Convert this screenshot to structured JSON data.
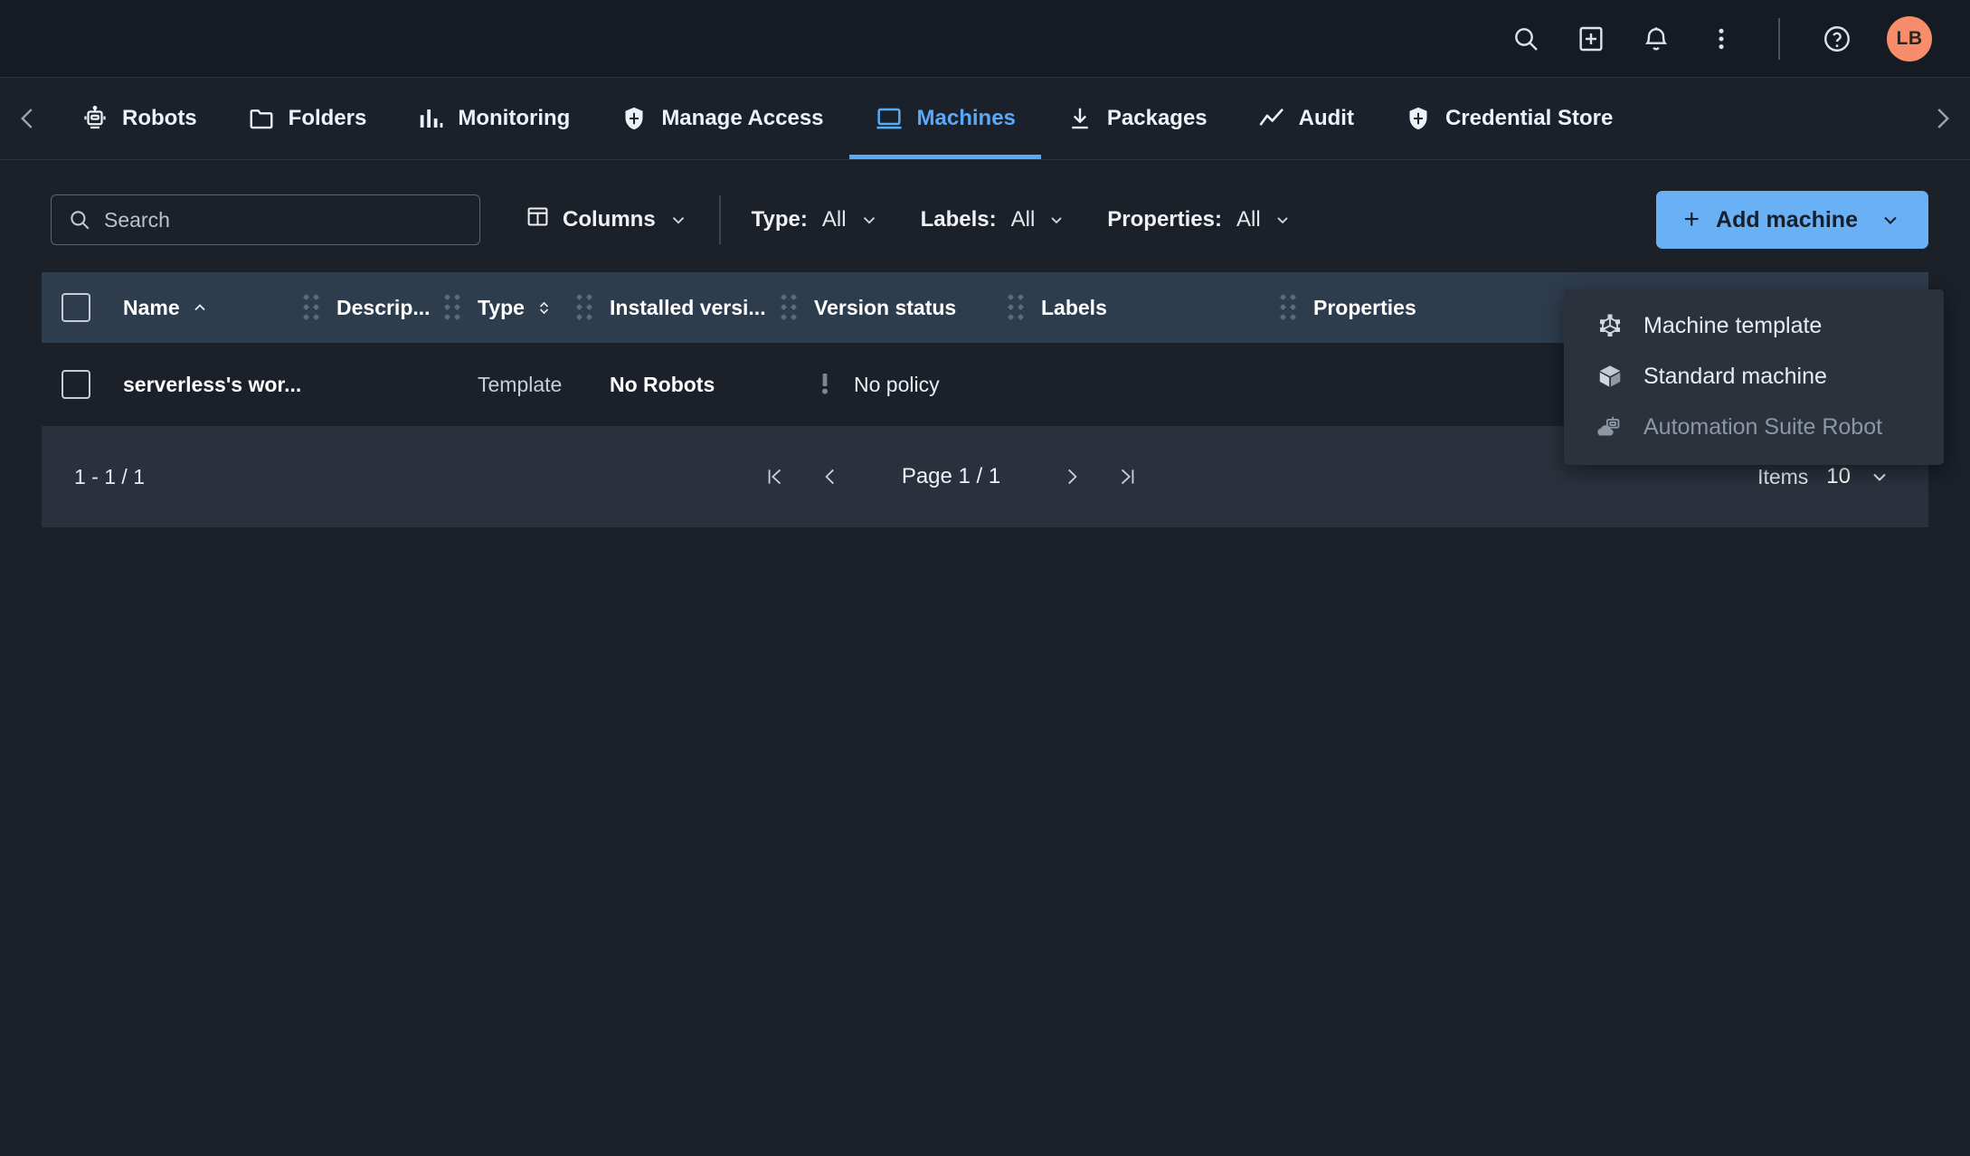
{
  "topbar": {
    "icons": [
      {
        "name": "search-icon",
        "label": "Search"
      },
      {
        "name": "add-square-icon",
        "label": "Create"
      },
      {
        "name": "bell-icon",
        "label": "Notifications"
      },
      {
        "name": "more-vertical-icon",
        "label": "More options"
      },
      {
        "name": "help-circle-icon",
        "label": "Help"
      }
    ],
    "avatar_initials": "LB"
  },
  "nav": {
    "prev_arrow": "chevron-left-icon",
    "next_arrow": "chevron-right-icon",
    "tabs": [
      {
        "label": "Robots",
        "icon": "robot-icon",
        "active": false
      },
      {
        "label": "Folders",
        "icon": "folder-icon",
        "active": false
      },
      {
        "label": "Monitoring",
        "icon": "bar-chart-icon",
        "active": false
      },
      {
        "label": "Manage Access",
        "icon": "shield-icon",
        "active": false
      },
      {
        "label": "Machines",
        "icon": "monitor-icon",
        "active": true
      },
      {
        "label": "Packages",
        "icon": "download-icon",
        "active": false
      },
      {
        "label": "Audit",
        "icon": "trend-line-icon",
        "active": false
      },
      {
        "label": "Credential Store",
        "icon": "shield-icon",
        "active": false
      }
    ]
  },
  "toolbar": {
    "search_placeholder": "Search",
    "search_value": "",
    "columns_label": "Columns",
    "filters": [
      {
        "label": "Type:",
        "value": "All"
      },
      {
        "label": "Labels:",
        "value": "All"
      },
      {
        "label": "Properties:",
        "value": "All"
      }
    ],
    "add_machine_label": "Add machine",
    "add_machine_plus": "+"
  },
  "add_machine_menu": {
    "open": true,
    "items": [
      {
        "label": "Machine template",
        "icon": "machine-template-icon",
        "disabled": false
      },
      {
        "label": "Standard machine",
        "icon": "cube-icon",
        "disabled": false
      },
      {
        "label": "Automation Suite Robot",
        "icon": "cloud-robot-icon",
        "disabled": true
      }
    ]
  },
  "table": {
    "columns": [
      {
        "label": "Name",
        "sort": "asc"
      },
      {
        "label": "Descrip...",
        "sort": null
      },
      {
        "label": "Type",
        "sort": "none"
      },
      {
        "label": "Installed versi...",
        "sort": null
      },
      {
        "label": "Version status",
        "sort": null
      },
      {
        "label": "Labels",
        "sort": null
      },
      {
        "label": "Properties",
        "sort": null
      }
    ],
    "rows": [
      {
        "name": "serverless's wor...",
        "description": "",
        "type": "Template",
        "installed_version": "No Robots",
        "version_status": "No policy",
        "version_status_icon": "warning-exclamation-icon",
        "labels": "",
        "properties": ""
      }
    ]
  },
  "footer": {
    "range": "1 - 1 / 1",
    "first_page_icon": "first-page-icon",
    "prev_page_icon": "prev-page-icon",
    "page_label": "Page 1 / 1",
    "next_page_icon": "next-page-icon",
    "last_page_icon": "last-page-icon",
    "items_label": "Items",
    "items_value": "10"
  },
  "colors": {
    "page_bg": "#1b2029",
    "topbar_bg": "#161b23",
    "accent": "#5aa9f8",
    "button_bg": "#6ab0f5",
    "table_header_bg": "#2e3d4e",
    "footer_bg": "#2a313c",
    "menu_bg": "#2b323c",
    "avatar_bg": "#f78d6a"
  }
}
